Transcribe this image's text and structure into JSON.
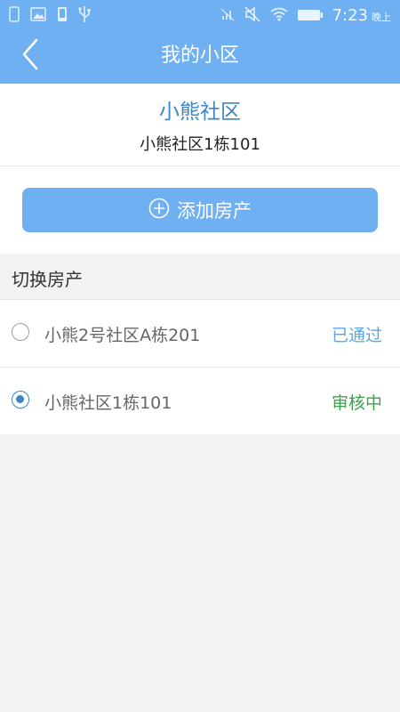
{
  "status_bar": {
    "time": "7:23",
    "period": "晚上",
    "left_icons": [
      "sim-icon",
      "image-icon",
      "phone-icon",
      "usb-icon"
    ],
    "right_icons": [
      "signal-icon",
      "mute-icon",
      "wifi-icon",
      "battery-icon"
    ]
  },
  "app_bar": {
    "title": "我的小区",
    "back_icon": "chevron-left-icon"
  },
  "current": {
    "community_name": "小熊社区",
    "address": "小熊社区1栋101"
  },
  "actions": {
    "add_property_label": "添加房产",
    "add_icon": "plus-circle-icon"
  },
  "switch_section": {
    "title": "切换房产"
  },
  "properties": [
    {
      "name": "小熊2号社区A栋201",
      "status": "已通过",
      "selected": false
    },
    {
      "name": "小熊社区1栋101",
      "status": "审核中",
      "selected": true
    }
  ],
  "colors": {
    "primary": "#6FB0F2",
    "accent": "#3A86C8",
    "approved": "#5DA5E6",
    "review": "#3AA24B",
    "background": "#F2F2F2"
  }
}
